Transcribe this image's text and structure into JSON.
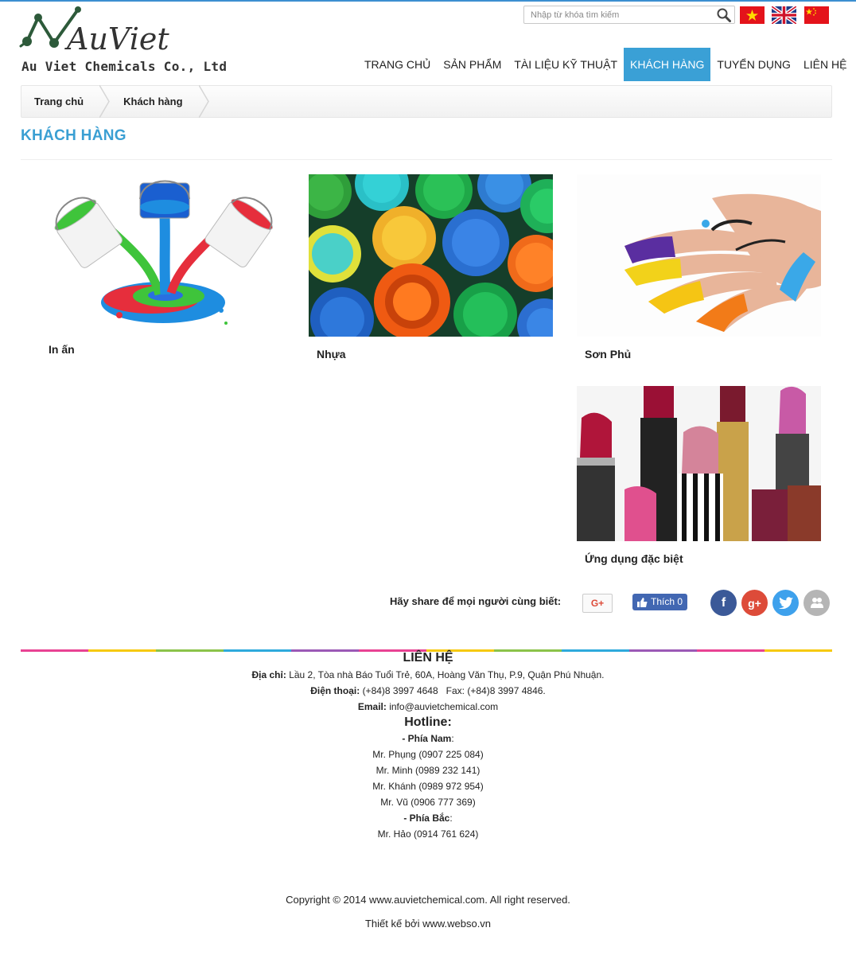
{
  "logo": {
    "brand": "AuViet",
    "company": "Au Viet Chemicals Co., Ltd"
  },
  "search": {
    "placeholder": "Nhập từ khóa tìm kiếm",
    "icon": "magnifier-icon"
  },
  "languages": [
    {
      "name": "vietnamese-flag"
    },
    {
      "name": "english-flag"
    },
    {
      "name": "chinese-flag"
    }
  ],
  "nav": {
    "items": [
      {
        "label": "TRANG CHỦ"
      },
      {
        "label": "SẢN PHẨM"
      },
      {
        "label": "TÀI LIỆU KỸ THUẬT"
      },
      {
        "label": "KHÁCH HÀNG",
        "active": true
      },
      {
        "label": "TUYỂN DỤNG"
      },
      {
        "label": "LIÊN HỆ"
      }
    ]
  },
  "breadcrumb": {
    "items": [
      "Trang chủ",
      "Khách hàng"
    ]
  },
  "page": {
    "title": "KHÁCH HÀNG"
  },
  "products": [
    {
      "label": "In ấn",
      "image": "paint-buckets-image"
    },
    {
      "label": "Nhựa",
      "image": "plastic-caps-image"
    },
    {
      "label": "Sơn Phủ",
      "image": "painted-fingers-image"
    },
    {
      "label": "Ứng dụng đặc biệt",
      "image": "lipsticks-image"
    }
  ],
  "share": {
    "label": "Hãy share để mọi người cùng biết:",
    "gplus_label": "G+",
    "fb_like_label": "Thích 0"
  },
  "colors": {
    "accent": "#3aa0d6",
    "title": "#3a9fd3",
    "facebook": "#3b5998",
    "google": "#dd4b39",
    "twitter": "#3ea1ec",
    "other": "#b5b5b5"
  },
  "footer": {
    "title": "LIÊN HỆ",
    "address_label": "Địa chỉ:",
    "address": "Lầu 2, Tòa nhà Báo Tuổi Trẻ, 60A, Hoàng Văn Thụ, P.9, Quận Phú Nhuận.",
    "phone_label": "Điện thoại:",
    "phone": "(+84)8 3997 4648",
    "fax": "Fax: (+84)8 3997 4846.",
    "email_label": "Email:",
    "email": "info@auvietchemical.com",
    "hotline_label": "Hotline:",
    "south_label": "- Phía Nam",
    "south_contacts": [
      "Mr. Phụng (0907 225 084)",
      "Mr. Minh (0989 232 141)",
      "Mr. Khánh (0989 972 954)",
      "Mr. Vũ (0906 777 369)"
    ],
    "north_label": "- Phía Bắc",
    "north_contacts": [
      "Mr. Hảo (0914 761 624)"
    ],
    "copyright": "Copyright © 2014 www.auvietchemical.com. All right reserved.",
    "designer": "Thiết kế bởi www.webso.vn"
  }
}
